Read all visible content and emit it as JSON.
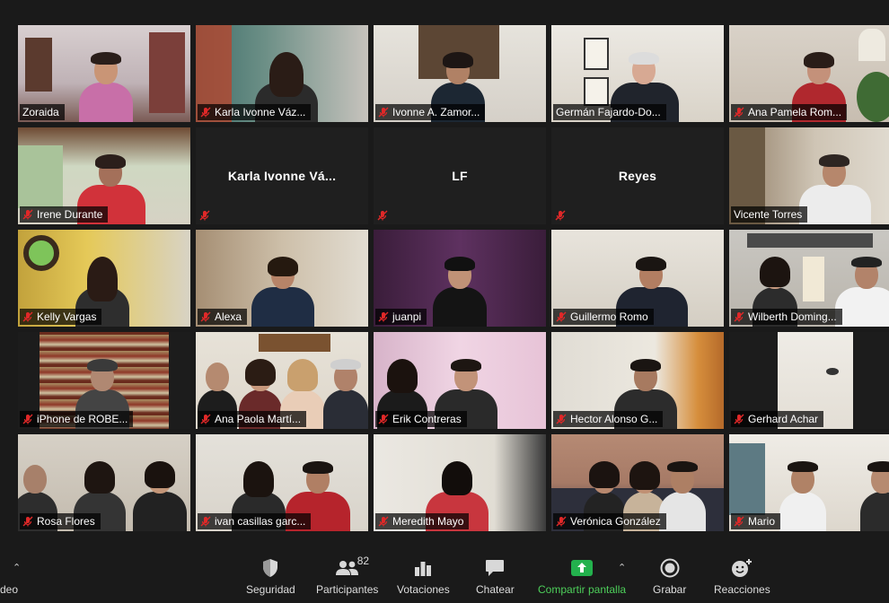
{
  "participants": [
    {
      "name": "Zoraida",
      "muted": false
    },
    {
      "name": "Karla Ivonne Váz...",
      "muted": true
    },
    {
      "name": "Ivonne A. Zamor...",
      "muted": true
    },
    {
      "name": "Germán Fajardo-Do...",
      "muted": false,
      "active": true
    },
    {
      "name": "Ana Pamela Rom...",
      "muted": true
    },
    {
      "name": "Irene Durante",
      "muted": true
    },
    {
      "name": "Karla Ivonne Vá...",
      "muted": true,
      "video_off": true
    },
    {
      "name": "LF",
      "muted": true,
      "video_off": true
    },
    {
      "name": "Reyes",
      "muted": true,
      "video_off": true
    },
    {
      "name": "Vicente Torres",
      "muted": false
    },
    {
      "name": "Kelly Vargas",
      "muted": true
    },
    {
      "name": "Alexa",
      "muted": true
    },
    {
      "name": "juanpi",
      "muted": true
    },
    {
      "name": "Guillermo Romo",
      "muted": true
    },
    {
      "name": "Wilberth Doming...",
      "muted": true
    },
    {
      "name": "iPhone de ROBE...",
      "muted": true
    },
    {
      "name": "Ana Paola Martí...",
      "muted": true
    },
    {
      "name": "Erik Contreras",
      "muted": true
    },
    {
      "name": "Hector Alonso G...",
      "muted": true
    },
    {
      "name": "Gerhard Achar",
      "muted": true
    },
    {
      "name": "Rosa Flores",
      "muted": true
    },
    {
      "name": "ivan casillas garc...",
      "muted": true
    },
    {
      "name": "Meredith Mayo",
      "muted": true
    },
    {
      "name": "Verónica González",
      "muted": true
    },
    {
      "name": "Mario",
      "muted": true
    }
  ],
  "toolbar": {
    "left_partial": "deo",
    "security": "Seguridad",
    "participants": "Participantes",
    "participants_count": "82",
    "polls": "Votaciones",
    "chat": "Chatear",
    "share": "Compartir pantalla",
    "record": "Grabar",
    "reactions": "Reacciones"
  },
  "colors": {
    "active_speaker_border": "#c5e35a",
    "share_green": "#23b14d",
    "mute_red": "#e02828"
  }
}
